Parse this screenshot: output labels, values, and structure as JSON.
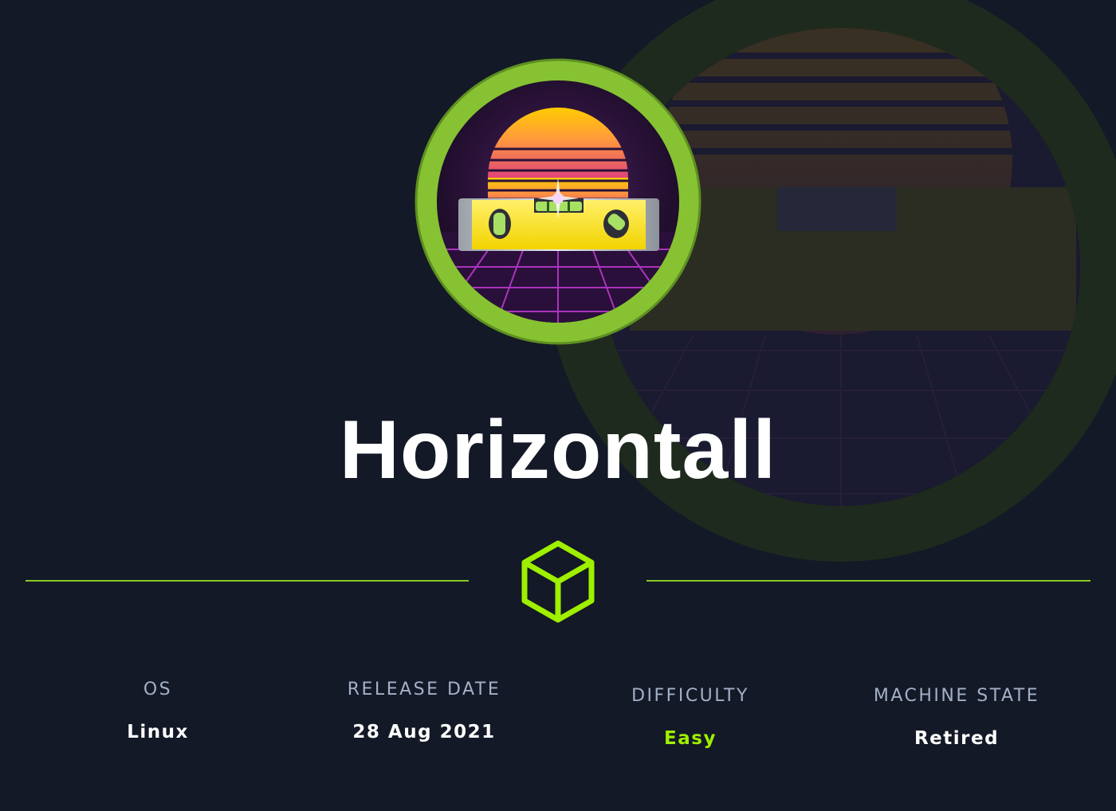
{
  "machine": {
    "name": "Horizontall"
  },
  "stats": {
    "os": {
      "label": "OS",
      "value": "Linux"
    },
    "release_date": {
      "label": "RELEASE DATE",
      "value": "28 Aug 2021"
    },
    "difficulty": {
      "label": "DIFFICULTY",
      "value": "Easy"
    },
    "machine_state": {
      "label": "MACHINE STATE",
      "value": "Retired"
    }
  },
  "icons": {
    "badge": "spirit-level-sunset-badge",
    "divider": "hackthebox-cube-icon"
  },
  "colors": {
    "background": "#131926",
    "accent": "#9fef00",
    "divider": "#8ac926",
    "badge_ring": "#86c232",
    "label": "#a3b0c8",
    "value": "#ffffff"
  }
}
